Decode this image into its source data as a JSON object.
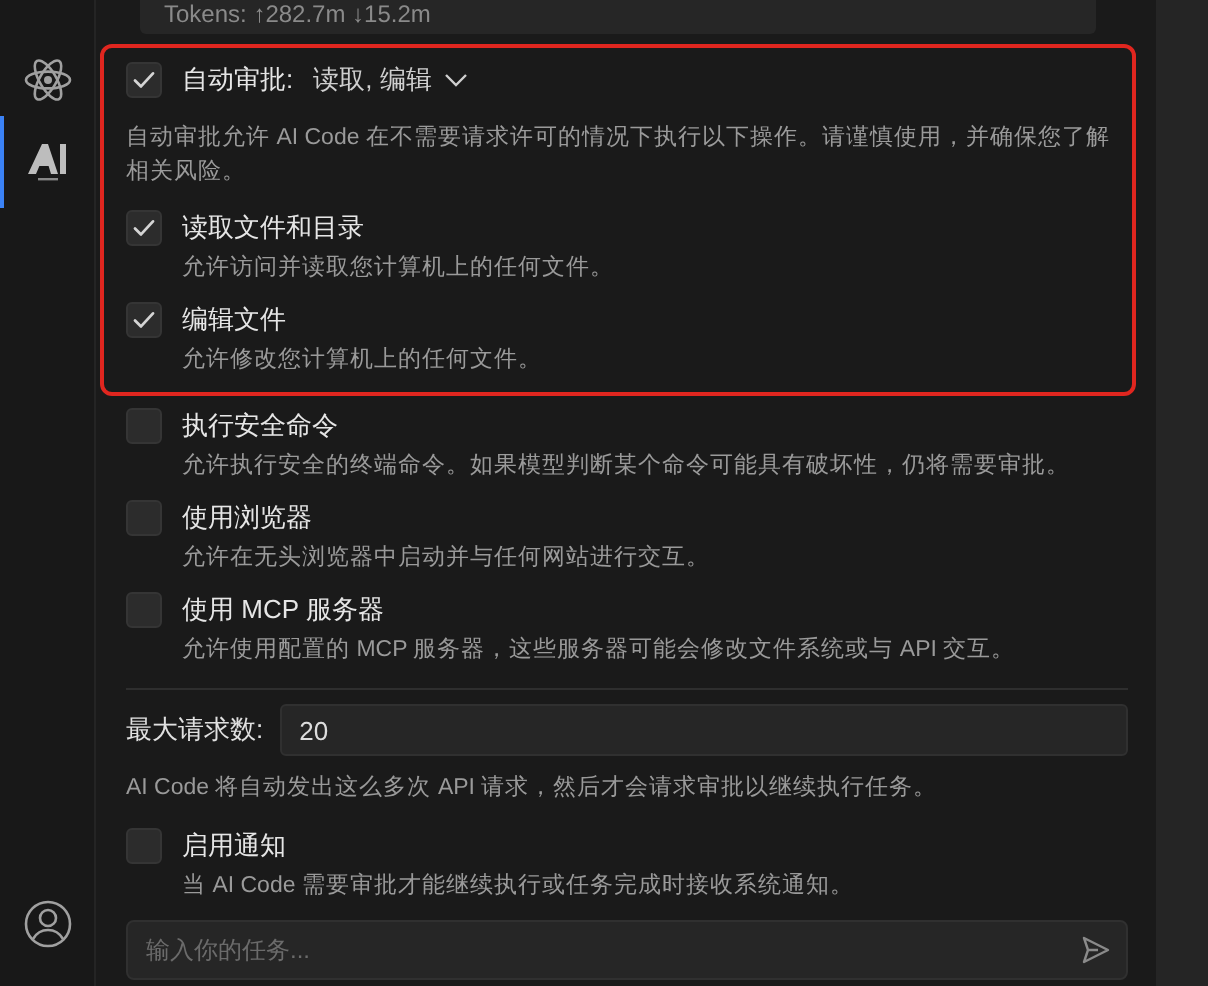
{
  "tokens": "Tokens: ↑282.7m ↓15.2m",
  "auto_approve": {
    "checked": true,
    "highlighted": true,
    "label": "自动审批:",
    "summary": "读取, 编辑",
    "description": "自动审批允许 AI Code 在不需要请求许可的情况下执行以下操作。请谨慎使用，并确保您了解相关风险。",
    "permissions": [
      {
        "label": "读取文件和目录",
        "description": "允许访问并读取您计算机上的任何文件。",
        "checked": true
      },
      {
        "label": "编辑文件",
        "description": "允许修改您计算机上的任何文件。",
        "checked": true
      }
    ]
  },
  "permissions": [
    {
      "label": "执行安全命令",
      "description": "允许执行安全的终端命令。如果模型判断某个命令可能具有破坏性，仍将需要审批。",
      "checked": false
    },
    {
      "label": "使用浏览器",
      "description": "允许在无头浏览器中启动并与任何网站进行交互。",
      "checked": false
    },
    {
      "label": "使用 MCP 服务器",
      "description": "允许使用配置的 MCP 服务器，这些服务器可能会修改文件系统或与 API 交互。",
      "checked": false
    }
  ],
  "max_requests": {
    "label": "最大请求数:",
    "value": "20",
    "description": "AI Code 将自动发出这么多次 API 请求，然后才会请求审批以继续执行任务。"
  },
  "notifications": {
    "label": "启用通知",
    "description": "当 AI Code 需要审批才能继续执行或任务完成时接收系统通知。",
    "checked": false
  },
  "task_input": {
    "placeholder": "输入你的任务..."
  }
}
